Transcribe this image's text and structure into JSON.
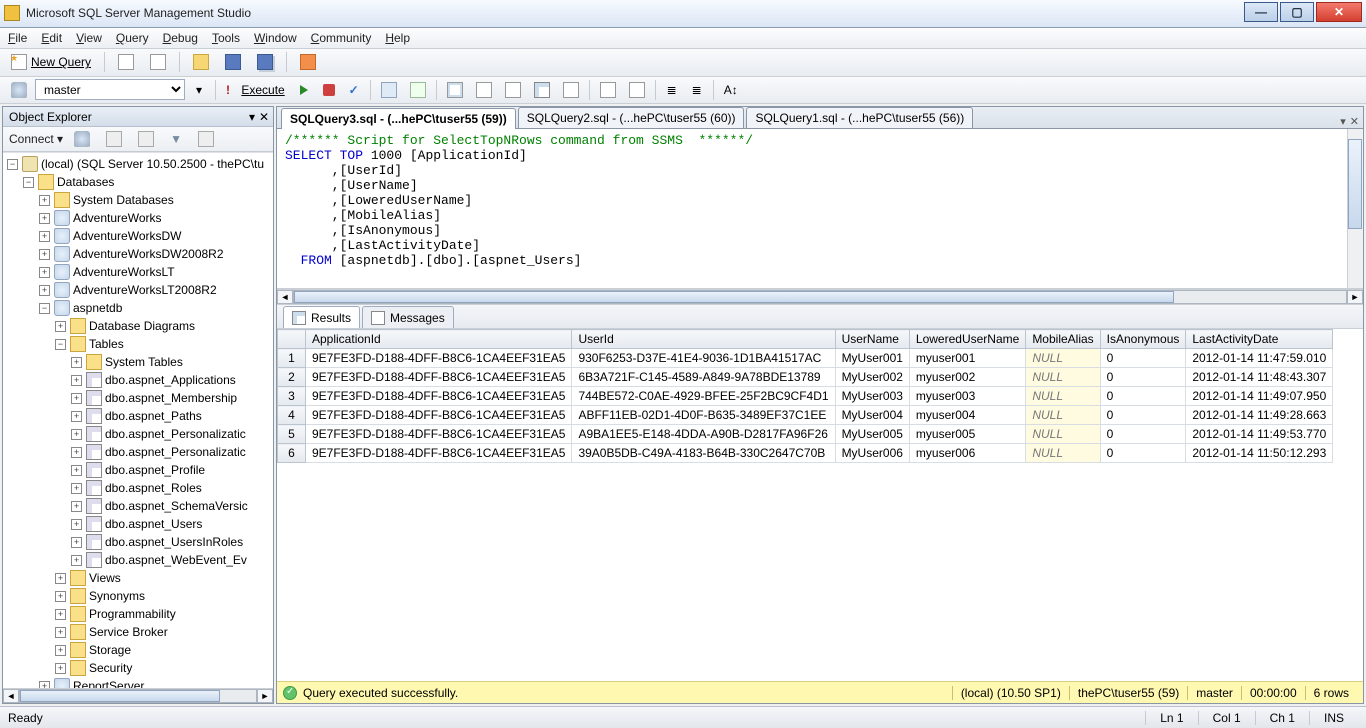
{
  "window": {
    "title": "Microsoft SQL Server Management Studio"
  },
  "menu": {
    "file": "File",
    "edit": "Edit",
    "view": "View",
    "query": "Query",
    "debug": "Debug",
    "tools": "Tools",
    "window": "Window",
    "community": "Community",
    "help": "Help"
  },
  "toolbar": {
    "newquery": "New Query",
    "execute": "Execute",
    "db_selected": "master"
  },
  "object_explorer": {
    "title": "Object Explorer",
    "connect": "Connect",
    "server": "(local) (SQL Server 10.50.2500 - thePC\\tu",
    "databases_label": "Databases",
    "sysdb": "System Databases",
    "dbs": [
      "AdventureWorks",
      "AdventureWorksDW",
      "AdventureWorksDW2008R2",
      "AdventureWorksLT",
      "AdventureWorksLT2008R2"
    ],
    "aspnetdb": "aspnetdb",
    "diagrams": "Database Diagrams",
    "tables": "Tables",
    "systables": "System Tables",
    "table_list": [
      "dbo.aspnet_Applications",
      "dbo.aspnet_Membership",
      "dbo.aspnet_Paths",
      "dbo.aspnet_Personalizatic",
      "dbo.aspnet_Personalizatic",
      "dbo.aspnet_Profile",
      "dbo.aspnet_Roles",
      "dbo.aspnet_SchemaVersic",
      "dbo.aspnet_Users",
      "dbo.aspnet_UsersInRoles",
      "dbo.aspnet_WebEvent_Ev"
    ],
    "other_nodes": [
      "Views",
      "Synonyms",
      "Programmability",
      "Service Broker",
      "Storage",
      "Security"
    ],
    "report_server": "ReportServer"
  },
  "tabs": {
    "t1": "SQLQuery3.sql - (...hePC\\tuser55 (59))",
    "t2": "SQLQuery2.sql - (...hePC\\tuser55 (60))",
    "t3": "SQLQuery1.sql - (...hePC\\tuser55 (56))"
  },
  "sql_lines": {
    "l1": "/****** Script for SelectTopNRows command from SSMS  ******/",
    "l2a": "SELECT",
    "l2b": " TOP",
    "l2c": " 1000 [ApplicationId]",
    "l3": "      ,[UserId]",
    "l4": "      ,[UserName]",
    "l5": "      ,[LoweredUserName]",
    "l6": "      ,[MobileAlias]",
    "l7": "      ,[IsAnonymous]",
    "l8": "      ,[LastActivityDate]",
    "l9a": "  FROM",
    "l9b": " [aspnetdb].[dbo].[aspnet_Users]"
  },
  "result_tab_labels": {
    "results": "Results",
    "messages": "Messages"
  },
  "columns": {
    "c1": "ApplicationId",
    "c2": "UserId",
    "c3": "UserName",
    "c4": "LoweredUserName",
    "c5": "MobileAlias",
    "c6": "IsAnonymous",
    "c7": "LastActivityDate"
  },
  "rows": [
    {
      "n": "1",
      "app": "9E7FE3FD-D188-4DFF-B8C6-1CA4EEF31EA5",
      "uid": "930F6253-D37E-41E4-9036-1D1BA41517AC",
      "un": "MyUser001",
      "lun": "myuser001",
      "ma": "NULL",
      "ia": "0",
      "lad": "2012-01-14 11:47:59.010"
    },
    {
      "n": "2",
      "app": "9E7FE3FD-D188-4DFF-B8C6-1CA4EEF31EA5",
      "uid": "6B3A721F-C145-4589-A849-9A78BDE13789",
      "un": "MyUser002",
      "lun": "myuser002",
      "ma": "NULL",
      "ia": "0",
      "lad": "2012-01-14 11:48:43.307"
    },
    {
      "n": "3",
      "app": "9E7FE3FD-D188-4DFF-B8C6-1CA4EEF31EA5",
      "uid": "744BE572-C0AE-4929-BFEE-25F2BC9CF4D1",
      "un": "MyUser003",
      "lun": "myuser003",
      "ma": "NULL",
      "ia": "0",
      "lad": "2012-01-14 11:49:07.950"
    },
    {
      "n": "4",
      "app": "9E7FE3FD-D188-4DFF-B8C6-1CA4EEF31EA5",
      "uid": "ABFF11EB-02D1-4D0F-B635-3489EF37C1EE",
      "un": "MyUser004",
      "lun": "myuser004",
      "ma": "NULL",
      "ia": "0",
      "lad": "2012-01-14 11:49:28.663"
    },
    {
      "n": "5",
      "app": "9E7FE3FD-D188-4DFF-B8C6-1CA4EEF31EA5",
      "uid": "A9BA1EE5-E148-4DDA-A90B-D2817FA96F26",
      "un": "MyUser005",
      "lun": "myuser005",
      "ma": "NULL",
      "ia": "0",
      "lad": "2012-01-14 11:49:53.770"
    },
    {
      "n": "6",
      "app": "9E7FE3FD-D188-4DFF-B8C6-1CA4EEF31EA5",
      "uid": "39A0B5DB-C49A-4183-B64B-330C2647C70B",
      "un": "MyUser006",
      "lun": "myuser006",
      "ma": "NULL",
      "ia": "0",
      "lad": "2012-01-14 11:50:12.293"
    }
  ],
  "status_yellow": {
    "msg": "Query executed successfully.",
    "conn": "(local) (10.50 SP1)",
    "user": "thePC\\tuser55 (59)",
    "db": "master",
    "time": "00:00:00",
    "rows": "6 rows"
  },
  "statusbar": {
    "ready": "Ready",
    "ln": "Ln 1",
    "col": "Col 1",
    "ch": "Ch 1",
    "ins": "INS"
  }
}
